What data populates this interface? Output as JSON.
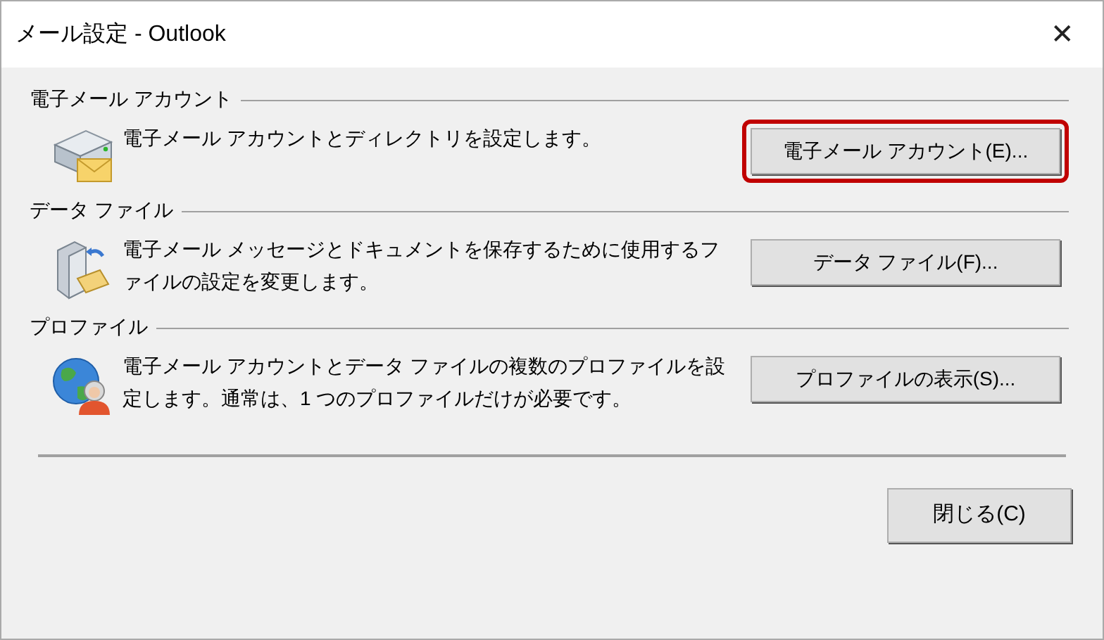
{
  "window": {
    "title": "メール設定 - Outlook",
    "close": "✕"
  },
  "sections": [
    {
      "kind": "email",
      "heading": "電子メール アカウント",
      "description": "電子メール アカウントとディレクトリを設定します。",
      "button": "電子メール アカウント(E)...",
      "highlighted": true
    },
    {
      "kind": "data",
      "heading": "データ ファイル",
      "description": "電子メール メッセージとドキュメントを保存するために使用するファイルの設定を変更します。",
      "button": "データ ファイル(F)...",
      "highlighted": false
    },
    {
      "kind": "profile",
      "heading": "プロファイル",
      "description": "電子メール アカウントとデータ ファイルの複数のプロファイルを設定します。通常は、1 つのプロファイルだけが必要です。",
      "button": "プロファイルの表示(S)...",
      "highlighted": false
    }
  ],
  "footer_button": "閉じる(C)"
}
